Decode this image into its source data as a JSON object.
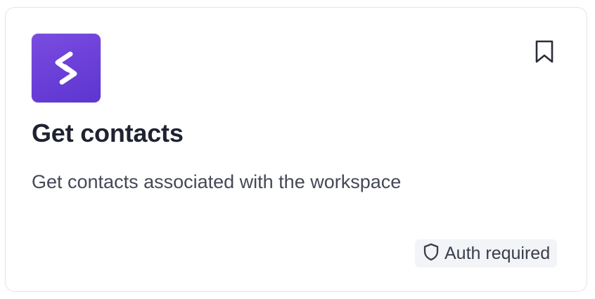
{
  "card": {
    "title": "Get contacts",
    "description": "Get contacts associated with the workspace",
    "logo_icon": "stacked-chevrons-logo",
    "bookmark_icon": "bookmark-icon",
    "badge": {
      "icon": "shield-icon",
      "label": "Auth required"
    }
  },
  "colors": {
    "logo_background": "#6a3fd8",
    "title_text": "#1f2230",
    "description_text": "#454857",
    "badge_background": "#f3f4f7",
    "card_border": "#e3e4e8"
  }
}
